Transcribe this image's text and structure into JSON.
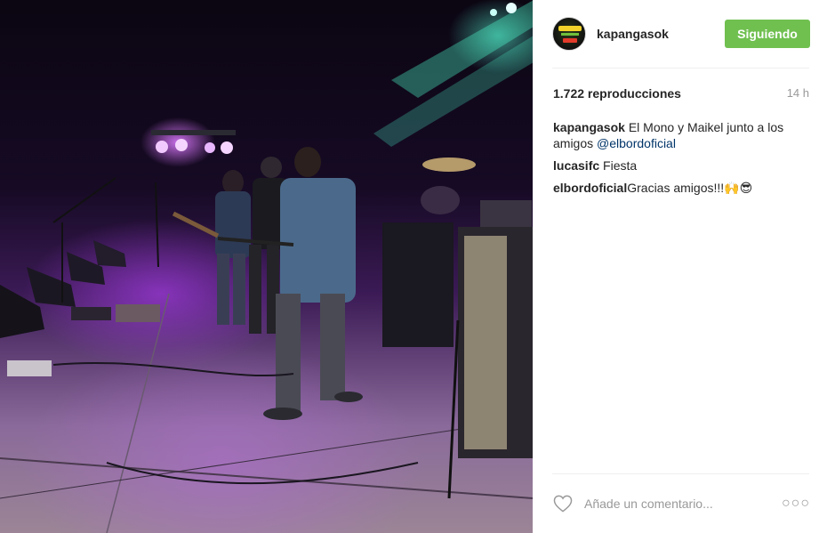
{
  "post": {
    "image_alt_subject": "",
    "author": {
      "username": "kapangasok",
      "follow_label": "Siguiendo"
    },
    "views": "1.722 reproducciones",
    "time": "14 h",
    "comments": [
      {
        "user": "kapangasok",
        "text": "El Mono y Maikel junto a los amigos",
        "mention": "@elbordoficial"
      },
      {
        "user": "lucasifc",
        "text": "Fiesta",
        "mention": ""
      },
      {
        "user": "elbordoficial",
        "text": "Gracias amigos!!!​🙌😎",
        "mention": ""
      }
    ],
    "add_comment_placeholder": "Añade un comentario...",
    "more_label": "○○○",
    "colors": {
      "follow_button": "#70c050",
      "mention": "#003569",
      "muted": "#999999"
    },
    "icons": {
      "like": "heart-icon",
      "options": "more-options-icon"
    }
  }
}
